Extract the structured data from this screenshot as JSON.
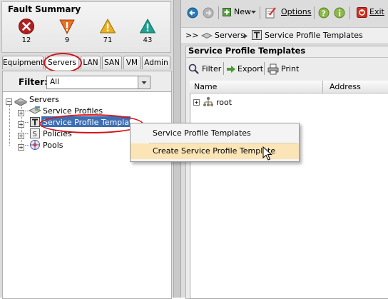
{
  "fault_summary": {
    "title": "Fault Summary",
    "items": [
      {
        "severity": "critical",
        "icon": "critical-x-icon",
        "count": "12",
        "color": "#b02020"
      },
      {
        "severity": "major",
        "icon": "major-triangle-down-icon",
        "count": "9",
        "color": "#e87020"
      },
      {
        "severity": "minor",
        "icon": "minor-warning-icon",
        "count": "71",
        "color": "#e8b020"
      },
      {
        "severity": "warning",
        "icon": "warning-triangle-icon",
        "count": "43",
        "color": "#20a090"
      }
    ]
  },
  "nav_tabs": [
    "Equipment",
    "Servers",
    "LAN",
    "SAN",
    "VM",
    "Admin"
  ],
  "active_tab": "Servers",
  "filter": {
    "label": "Filter:",
    "value": "All"
  },
  "tree": {
    "root": "Servers",
    "children": [
      "Service Profiles",
      "Service Profile Templates",
      "Policies",
      "Pools"
    ],
    "selected": "Service Profile Templates"
  },
  "toolbar": {
    "new_label": "New",
    "options_label": "Options",
    "exit_label": "Exit"
  },
  "breadcrumb": {
    "prefix": ">>",
    "items": [
      "Servers",
      "Service Profile Templates"
    ]
  },
  "panel": {
    "title": "Service Profile Templates",
    "actions": {
      "filter": "Filter",
      "export": "Export",
      "print": "Print"
    },
    "columns": [
      "Name",
      "Address"
    ],
    "rows": [
      "root"
    ]
  },
  "context_menu": {
    "items": [
      "Service Profile Templates",
      "Create Service Profile Template"
    ],
    "highlighted": "Create Service Profile Template"
  },
  "colors": {
    "selection": "#3e6fb4",
    "annotation_red": "#d4141c",
    "menu_highlight": "#fbe5b6"
  }
}
